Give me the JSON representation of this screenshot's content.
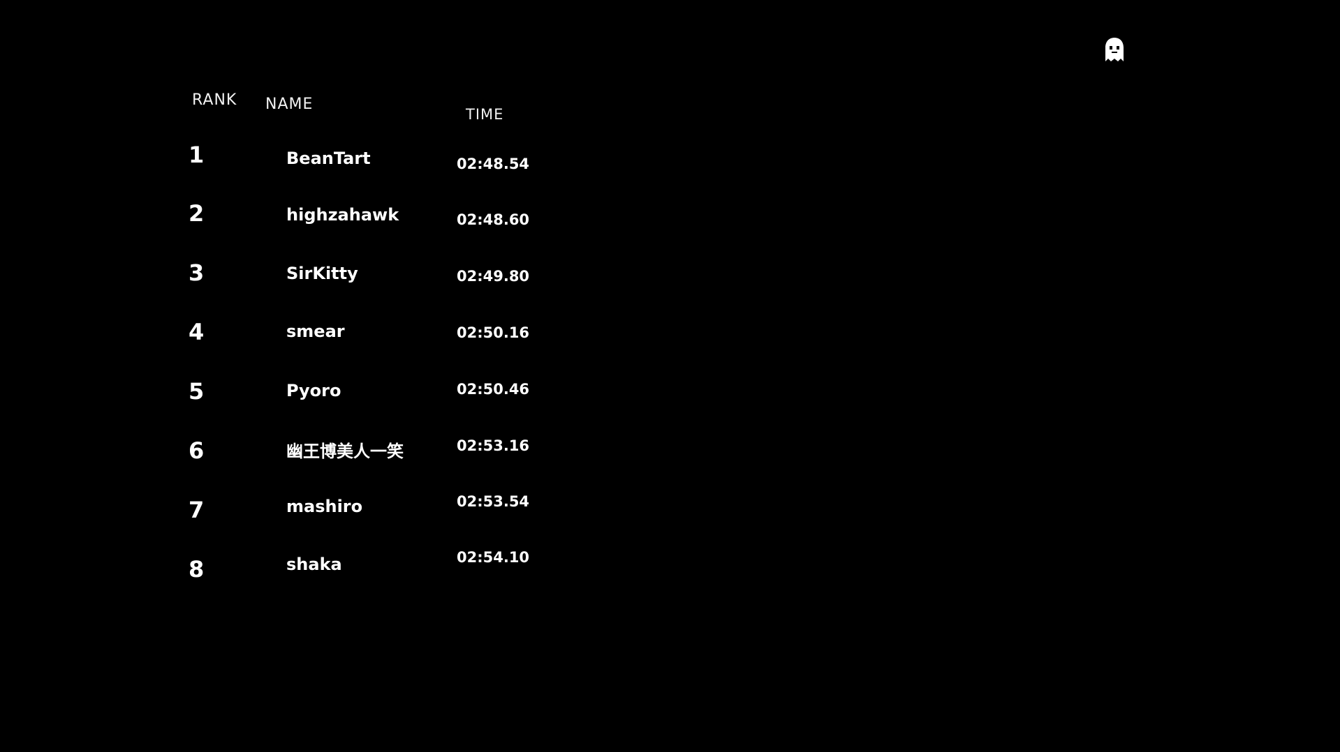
{
  "leaderboard": {
    "headers": {
      "rank": "RANK",
      "name": "NAME",
      "time": "TIME"
    },
    "entries": [
      {
        "rank": "1",
        "name": "BeanTart",
        "time": "02:48.54"
      },
      {
        "rank": "2",
        "name": "highzahawk",
        "time": "02:48.60"
      },
      {
        "rank": "3",
        "name": "SirKitty",
        "time": "02:49.80"
      },
      {
        "rank": "4",
        "name": "smear",
        "time": "02:50.16"
      },
      {
        "rank": "5",
        "name": "Pyoro",
        "time": "02:50.46"
      },
      {
        "rank": "6",
        "name": "幽王博美人一笑",
        "time": "02:53.16"
      },
      {
        "rank": "7",
        "name": "mashiro",
        "time": "02:53.54"
      },
      {
        "rank": "8",
        "name": "shaka",
        "time": "02:54.10"
      }
    ]
  },
  "corner_icon": "ghost-icon",
  "colors": {
    "background": "#000000",
    "text": "#ffffff"
  }
}
